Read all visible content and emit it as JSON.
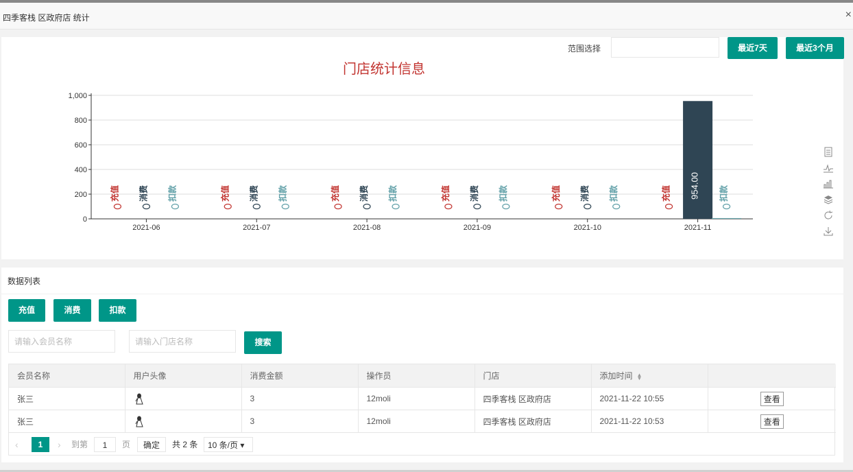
{
  "window": {
    "title": "四季客栈 区政府店 统计",
    "close_glyph": "×"
  },
  "filter": {
    "range_label": "范围选择",
    "btn_7d": "最近7天",
    "btn_3m": "最近3个月"
  },
  "chart_data": {
    "type": "bar",
    "title": "门店统计信息",
    "categories": [
      "2021-06",
      "2021-07",
      "2021-08",
      "2021-09",
      "2021-10",
      "2021-11"
    ],
    "series": [
      {
        "name": "充值",
        "color": "#c23531",
        "values": [
          0,
          0,
          0,
          0,
          0,
          0
        ]
      },
      {
        "name": "消费",
        "color": "#2f4554",
        "values": [
          0,
          0,
          0,
          0,
          0,
          954.0
        ]
      },
      {
        "name": "扣款",
        "color": "#61a0a8",
        "values": [
          0,
          0,
          0,
          0,
          0,
          6
        ]
      }
    ],
    "value_label": "954.00",
    "ylim": [
      0,
      1000
    ],
    "yticks": [
      "0",
      "200",
      "400",
      "600",
      "800",
      "1,000"
    ],
    "grid": true
  },
  "toolbox": {
    "icons": [
      "data-view-icon",
      "line-chart-icon",
      "bar-chart-icon",
      "stack-icon",
      "restore-icon",
      "download-icon"
    ]
  },
  "list": {
    "title": "数据列表",
    "btn_recharge": "充值",
    "btn_consume": "消费",
    "btn_deduct": "扣款",
    "member_placeholder": "请输入会员名称",
    "store_placeholder": "请输入门店名称",
    "btn_search": "搜索",
    "columns": [
      "会员名称",
      "用户头像",
      "消费金额",
      "操作员",
      "门店",
      "添加时间",
      ""
    ],
    "rows": [
      {
        "member": "张三",
        "amount": "3",
        "operator": "12moli",
        "store": "四季客栈 区政府店",
        "time": "2021-11-22 10:55",
        "action": "查看"
      },
      {
        "member": "张三",
        "amount": "3",
        "operator": "12moli",
        "store": "四季客栈 区政府店",
        "time": "2021-11-22 10:53",
        "action": "查看"
      }
    ]
  },
  "pager": {
    "prev": "‹",
    "current": "1",
    "next": "›",
    "goto": "到第",
    "goto_value": "1",
    "page": "页",
    "ok": "确定",
    "total": "共 2 条",
    "size": "10 条/页"
  }
}
